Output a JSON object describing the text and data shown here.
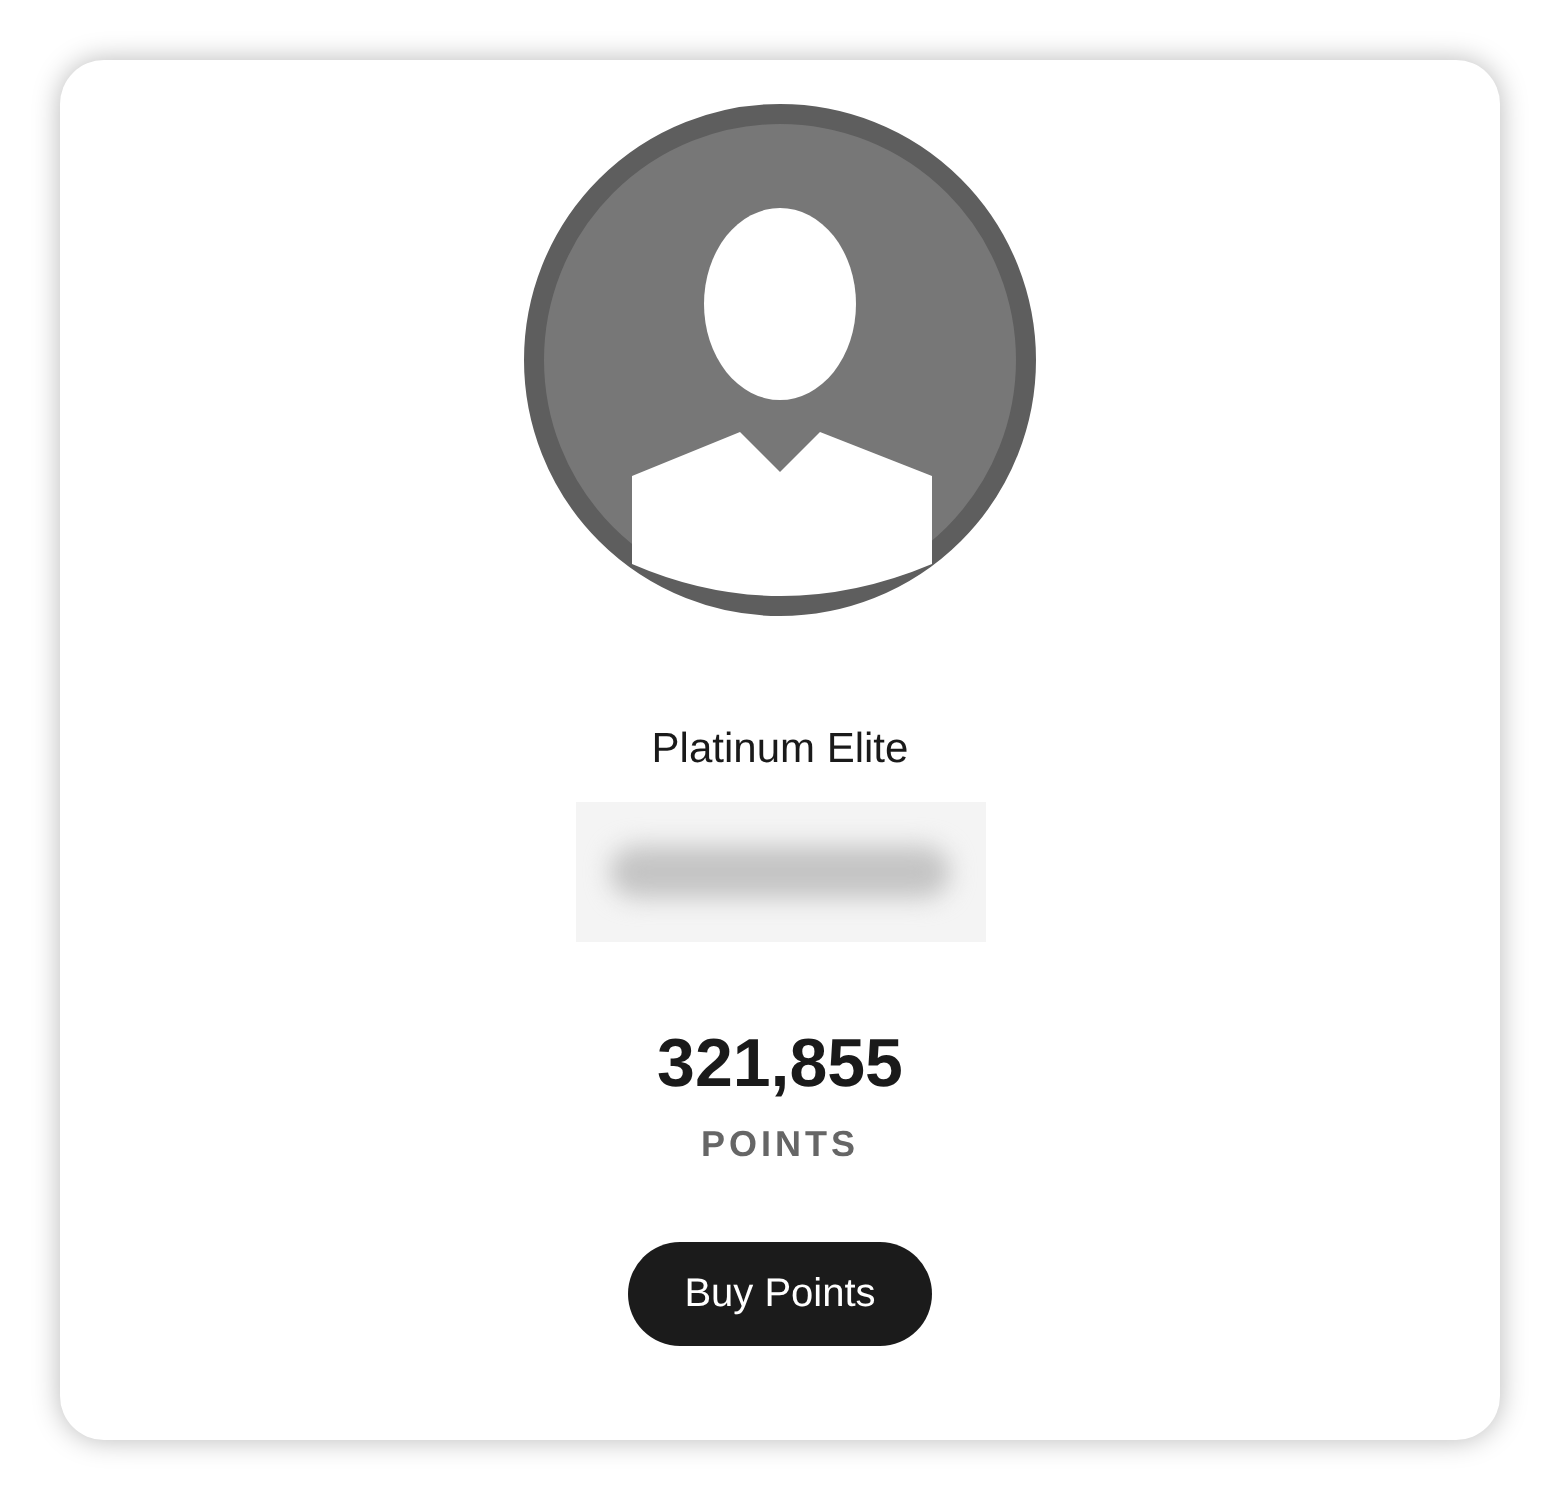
{
  "profile": {
    "tier": "Platinum Elite",
    "name_redacted": true
  },
  "points": {
    "value": "321,855",
    "label": "POINTS"
  },
  "buttons": [
    {
      "label": "Buy Points"
    }
  ]
}
